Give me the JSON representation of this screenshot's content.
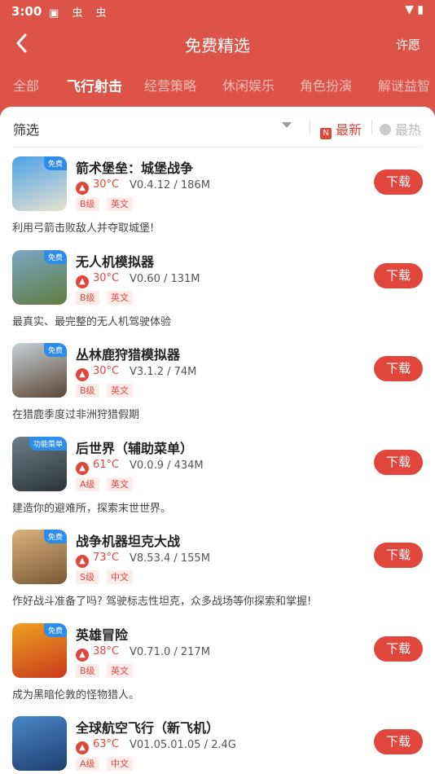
{
  "status": {
    "time": "3:00",
    "left_icons": "▣ 虫 虫",
    "right_icons": "▼ ▮"
  },
  "title": "免费精选",
  "wish_label": "许愿",
  "tabs": [
    "全部",
    "飞行射击",
    "经营策略",
    "休闲娱乐",
    "角色扮演",
    "解谜益智"
  ],
  "active_tab": "飞行射击",
  "filter": {
    "label": "筛选",
    "sort_new": "最新",
    "sort_hot": "最热"
  },
  "games": [
    {
      "name": "箭术堡垒：城堡战争",
      "heat": "30°C",
      "version": "V0.4.12 / 186M",
      "tags": [
        "B级",
        "英文"
      ],
      "desc": "利用弓箭击败敌人并夺取城堡!",
      "badge": "免费",
      "colors": [
        "#4aa3e8",
        "#e9e1cf"
      ]
    },
    {
      "name": "无人机模拟器",
      "heat": "30°C",
      "version": "V0.60 / 131M",
      "tags": [
        "B级",
        "英文"
      ],
      "desc": "最真实、最完整的无人机驾驶体验",
      "badge": "免费",
      "colors": [
        "#7aa6c6",
        "#5f7d3e"
      ]
    },
    {
      "name": "丛林鹿狩猎模拟器",
      "heat": "30°C",
      "version": "V3.1.2 / 74M",
      "tags": [
        "B级",
        "英文"
      ],
      "desc": "在猎鹿季度过非洲狩猎假期",
      "badge": "免费",
      "colors": [
        "#c7d2d8",
        "#5b4636"
      ]
    },
    {
      "name": "后世界（辅助菜单）",
      "heat": "61°C",
      "version": "V0.0.9 / 434M",
      "tags": [
        "A级",
        "英文"
      ],
      "desc": "建造你的避难所，探索末世世界。",
      "badge": "功能菜单",
      "colors": [
        "#6c7f86",
        "#2c3338"
      ]
    },
    {
      "name": "战争机器坦克大战",
      "heat": "73°C",
      "version": "V8.53.4 / 155M",
      "tags": [
        "S级",
        "中文"
      ],
      "desc": "作好战斗准备了吗? 驾驶标志性坦克，众多战场等你探索和掌握!",
      "badge": "免费",
      "colors": [
        "#d9b27c",
        "#7a5a34"
      ]
    },
    {
      "name": "英雄冒险",
      "heat": "38°C",
      "version": "V0.71.0 / 217M",
      "tags": [
        "B级",
        "英文"
      ],
      "desc": "成为黑暗伦敦的怪物猎人。",
      "badge": "免费",
      "colors": [
        "#f0a020",
        "#c83a1c"
      ]
    },
    {
      "name": "全球航空飞行（新飞机）",
      "heat": "63°C",
      "version": "V01.05.01.05 / 2.4G",
      "tags": [
        "A级",
        "中文"
      ],
      "desc": "",
      "badge": "",
      "colors": [
        "#4a87c9",
        "#1d3f6e"
      ]
    }
  ],
  "download_label": "下载"
}
